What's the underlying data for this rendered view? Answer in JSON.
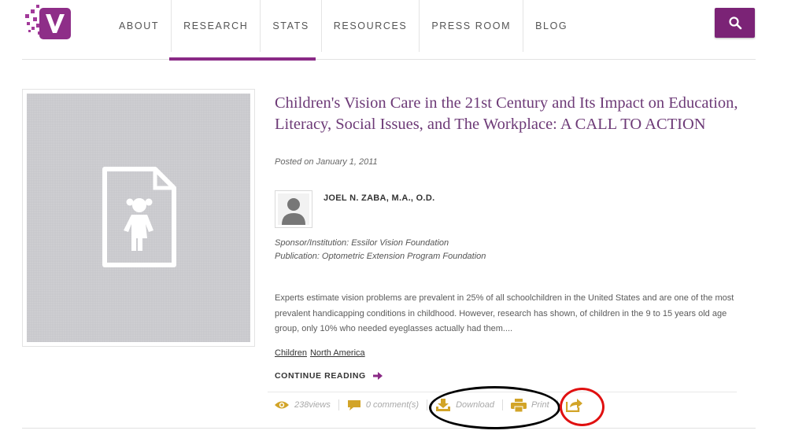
{
  "brand": {
    "logo_icon": "v-logo-icon",
    "accent": "#7b2376"
  },
  "nav": {
    "items": [
      {
        "label": "ABOUT"
      },
      {
        "label": "RESEARCH",
        "active": true
      },
      {
        "label": "STATS"
      },
      {
        "label": "RESOURCES"
      },
      {
        "label": "PRESS ROOM"
      },
      {
        "label": "BLOG"
      }
    ],
    "search_icon": "search-icon"
  },
  "article": {
    "title": "Children's Vision Care in the 21st Century and Its Impact on Education, Literacy, Social Issues, and The Workplace: A CALL TO ACTION",
    "posted": "Posted on January 1, 2011",
    "author": "JOEL N. ZABA, M.A., O.D.",
    "sponsor": "Sponsor/Institution: Essilor Vision Foundation",
    "publication": "Publication: Optometric Extension Program Foundation",
    "excerpt": "Experts estimate vision problems are prevalent in 25% of all schoolchildren in the United States and are one of the most prevalent handicapping conditions in childhood. However, research has shown, of children in the 9 to 15 years old age group, only 10% who needed eyeglasses actually had them....",
    "tags": [
      "Children",
      "North America"
    ],
    "continue_label": "CONTINUE READING"
  },
  "actions": {
    "views": "238views",
    "comments": "0 comment(s)",
    "download": "Download",
    "print": "Print"
  }
}
